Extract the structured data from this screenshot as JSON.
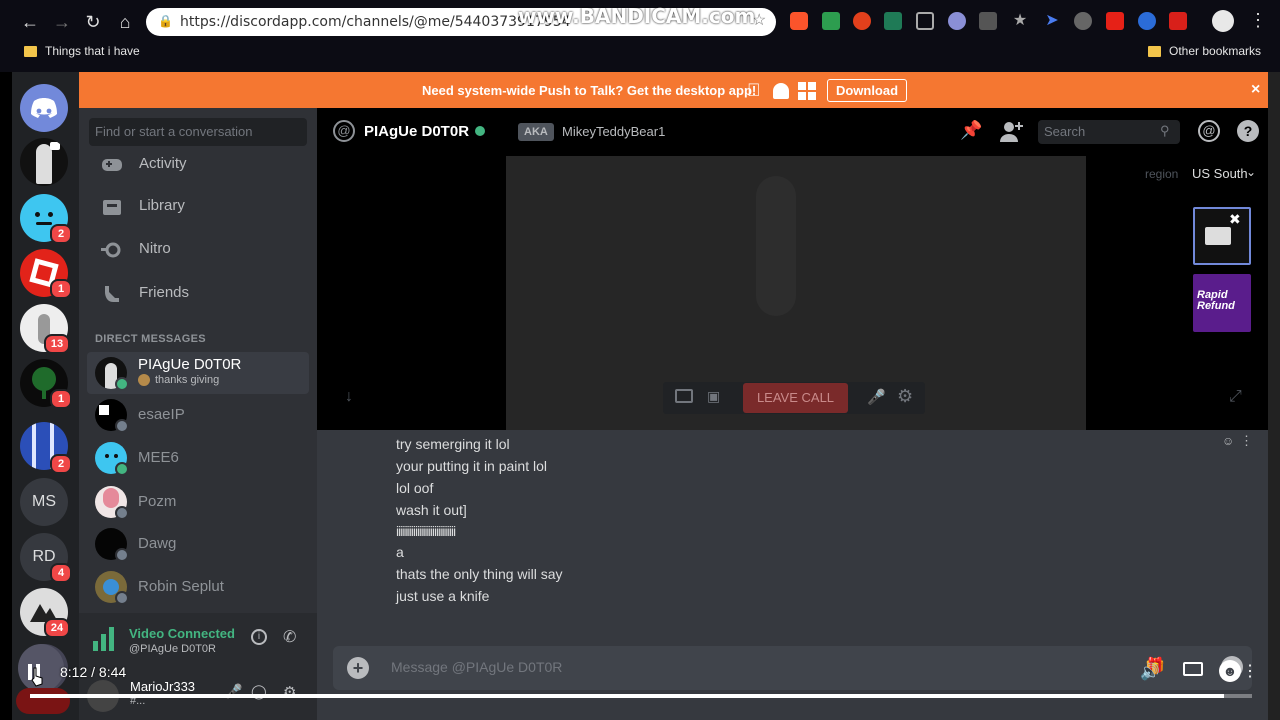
{
  "browser": {
    "url": "https://discordapp.com/channels/@me/5440373917954",
    "watermark": "www.BANDICAM.com",
    "bookmarks": [
      {
        "label": "Things that i have"
      },
      {
        "label": "Other bookmarks"
      }
    ]
  },
  "banner": {
    "text": "Need system-wide Push to Talk? Get the desktop app!",
    "download_label": "Download",
    "color": "#f57731"
  },
  "guilds": {
    "badges": [
      "2",
      "1",
      "13",
      "1",
      "2",
      "4",
      "24"
    ],
    "initials": [
      "MS",
      "RD"
    ]
  },
  "dm_panel": {
    "search_placeholder": "Find or start a conversation",
    "nav": [
      {
        "label": "Activity",
        "icon": "gamepad-icon"
      },
      {
        "label": "Library",
        "icon": "library-icon"
      },
      {
        "label": "Nitro",
        "icon": "nitro-icon"
      },
      {
        "label": "Friends",
        "icon": "friends-icon"
      }
    ],
    "section_title": "DIRECT MESSAGES",
    "dms": [
      {
        "name": "PIAgUe D0T0R",
        "status": "thanks giving"
      },
      {
        "name": "esaeIP"
      },
      {
        "name": "MEE6"
      },
      {
        "name": "Pozm"
      },
      {
        "name": "Dawg"
      },
      {
        "name": "Robin Seplut"
      }
    ],
    "voice": {
      "title": "Video Connected",
      "channel": "@PIAgUe D0T0R"
    },
    "user": {
      "name": "MarioJr333",
      "tag": "#..."
    }
  },
  "header": {
    "username": "PIAgUe D0T0R",
    "aka_label": "AKA",
    "aka_name": "MikeyTeddyBear1",
    "search_placeholder": "Search"
  },
  "call": {
    "region_label": "region",
    "region_value": "US South",
    "leave_label": "LEAVE CALL",
    "thumb2_text": "Rapid Refund"
  },
  "messages": [
    "try semerging it lol",
    "your putting it in paint lol",
    "lol oof",
    "wash it out]",
    "iiiiiiiiiiiiiiiiiiiiiiiiiiii",
    "a",
    "thats the only thing  will say",
    "just use a knife"
  ],
  "composer": {
    "placeholder": "Message @PIAgUe D0T0R"
  },
  "player": {
    "time": "8:12 / 8:44",
    "progress": 0.977
  }
}
